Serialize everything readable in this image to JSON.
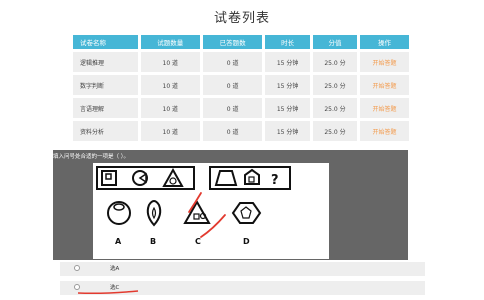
{
  "page": {
    "title": "试卷列表"
  },
  "table": {
    "headers": [
      "试卷名称",
      "试题数量",
      "已答题数",
      "时长",
      "分值",
      "操作"
    ],
    "rows": [
      {
        "name": "逻辑推理",
        "count": "10 道",
        "answered": "0 道",
        "duration": "15 分钟",
        "score": "25.0 分",
        "action": "开始答题"
      },
      {
        "name": "数字判断",
        "count": "10 道",
        "answered": "0 道",
        "duration": "15 分钟",
        "score": "25.0 分",
        "action": "开始答题"
      },
      {
        "name": "言语理解",
        "count": "10 道",
        "answered": "0 道",
        "duration": "15 分钟",
        "score": "25.0 分",
        "action": "开始答题"
      },
      {
        "name": "资料分析",
        "count": "10 道",
        "answered": "0 道",
        "duration": "15 分钟",
        "score": "25.0 分",
        "action": "开始答题"
      }
    ]
  },
  "question": {
    "text": "填入问号处合适的一项是（ ）。",
    "figure": {
      "question_mark": "?",
      "choice_labels": [
        "A",
        "B",
        "C",
        "D"
      ]
    }
  },
  "options": [
    {
      "label": "选A"
    },
    {
      "label": "选C"
    }
  ],
  "accent_colors": {
    "header": "#46b6d6",
    "action": "#f39a4b",
    "panel": "#666666",
    "annotation": "#e23a2f"
  }
}
